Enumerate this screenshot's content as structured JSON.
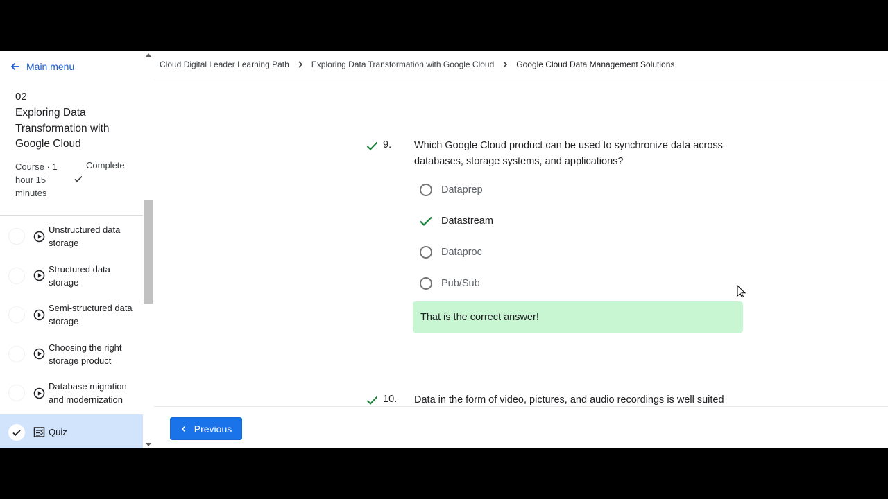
{
  "sidebar": {
    "main_menu": "Main menu",
    "course_number": "02",
    "course_title": "Exploring Data Transformation with Google Cloud",
    "course_meta": "Course · 1 hour 15 minutes",
    "course_status": "Complete",
    "items": [
      {
        "label": "Unstructured data storage",
        "icon": "play-circle-icon"
      },
      {
        "label": "Structured data storage",
        "icon": "play-circle-icon"
      },
      {
        "label": "Semi-structured data storage",
        "icon": "play-circle-icon"
      },
      {
        "label": "Choosing the right storage product",
        "icon": "play-circle-icon"
      },
      {
        "label": "Database migration and modernization",
        "icon": "play-circle-icon"
      },
      {
        "label": "Quiz",
        "icon": "quiz-icon",
        "completed": true
      }
    ]
  },
  "breadcrumb": {
    "level1": "Cloud Digital Leader Learning Path",
    "level2": "Exploring Data Transformation with Google Cloud",
    "level3": "Google Cloud Data Management Solutions"
  },
  "quiz": {
    "q9": {
      "number": "9.",
      "text": "Which Google Cloud product can be used to synchronize data across databases, storage systems, and applications?",
      "options": [
        "Dataprep",
        "Datastream",
        "Dataproc",
        "Pub/Sub"
      ],
      "selected": "Datastream",
      "feedback": "That is the correct answer!"
    },
    "q10": {
      "number": "10.",
      "text": "Data in the form of video, pictures, and audio recordings is well suited"
    }
  },
  "footer": {
    "previous_label": "Previous"
  },
  "colors": {
    "accent": "#1a73e8",
    "correct": "#188038",
    "feedback_bg": "#c8f5d2"
  }
}
